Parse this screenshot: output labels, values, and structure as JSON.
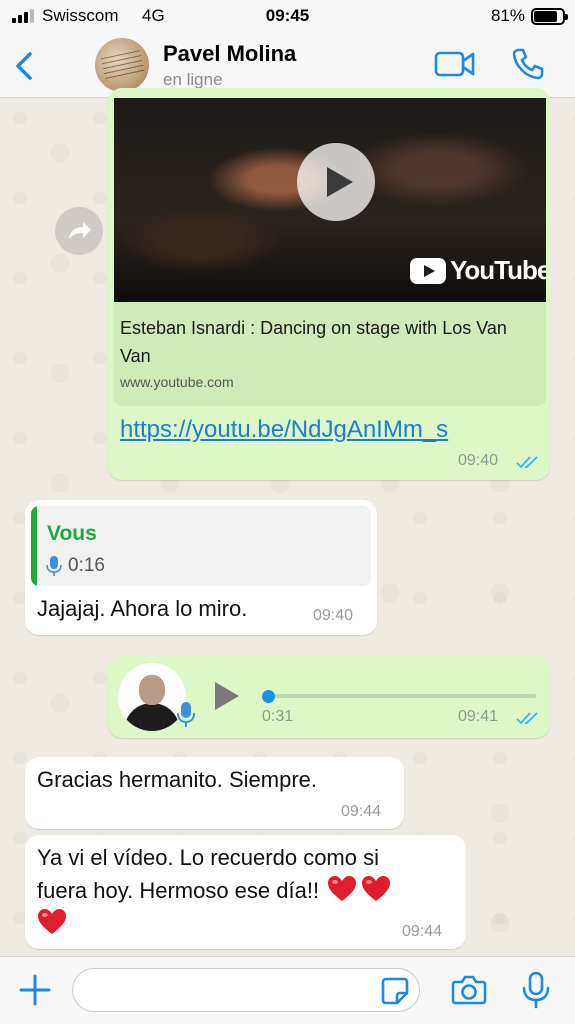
{
  "status_bar": {
    "carrier": "Swisscom",
    "network": "4G",
    "time": "09:45",
    "battery_percent": "81%",
    "battery_level": 0.81
  },
  "header": {
    "back_icon": "chevron-left-icon",
    "contact_name": "Pavel Molina",
    "contact_status": "en ligne",
    "video_icon": "video-camera-icon",
    "phone_icon": "phone-icon",
    "accent_color": "#1E88E5"
  },
  "messages": {
    "link_preview": {
      "direction": "outgoing",
      "thumbnail_brand": "YouTube",
      "title": "Esteban Isnardi : Dancing on stage with Los Van Van",
      "domain": "www.youtube.com",
      "link": "https://youtu.be/NdJgAnIMm_s",
      "time": "09:40",
      "read": true
    },
    "reply": {
      "direction": "incoming",
      "quote_author": "Vous",
      "quote_duration": "0:16",
      "text": "Jajajaj. Ahora lo miro.",
      "time": "09:40"
    },
    "voice": {
      "direction": "outgoing",
      "duration": "0:31",
      "time": "09:41",
      "progress": 0.0,
      "read": true
    },
    "gracias": {
      "direction": "incoming",
      "text": "Gracias hermanito. Siempre.",
      "time": "09:44"
    },
    "ya_vi": {
      "direction": "incoming",
      "line1": "Ya vi el vídeo. Lo recuerdo como si",
      "line2": "fuera hoy. Hermoso ese día!!",
      "time": "09:44",
      "emoji": "red-heart-icon"
    }
  },
  "composer": {
    "plus_icon": "plus-icon",
    "input_value": "",
    "sticker_icon": "sticker-icon",
    "camera_icon": "camera-icon",
    "mic_icon": "microphone-icon"
  },
  "colors": {
    "outgoing_bubble": "#DCF8C6",
    "incoming_bubble": "#FFFFFF",
    "quote_green": "#1FAA3B",
    "read_ticks": "#34B7F1",
    "link": "#1F7BD6"
  }
}
